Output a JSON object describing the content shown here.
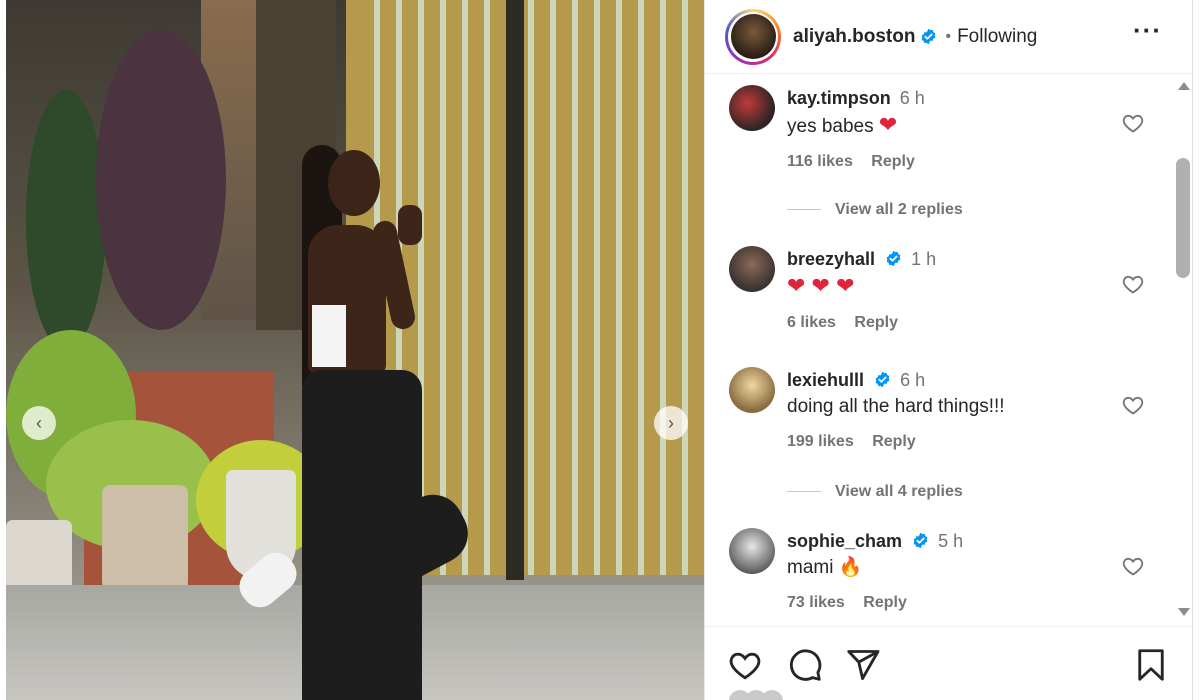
{
  "post": {
    "carousel_prev": "‹",
    "carousel_next": "›"
  },
  "header": {
    "username": "aliyah.boston",
    "separator": "•",
    "following_label": "Following",
    "more_label": "···"
  },
  "comments": [
    {
      "username": "kay.timpson",
      "time": "6 h",
      "text": "yes babes",
      "emoji": "❤",
      "likes": "116 likes",
      "reply": "Reply",
      "verified": false
    },
    {
      "username": "breezyhall",
      "time": "1 h",
      "text": "",
      "emoji": "❤ ❤ ❤",
      "likes": "6 likes",
      "reply": "Reply",
      "verified": true
    },
    {
      "username": "lexiehulll",
      "time": "6 h",
      "text": "doing all the hard things!!!",
      "emoji": "",
      "likes": "199 likes",
      "reply": "Reply",
      "verified": true
    },
    {
      "username": "sophie_cham",
      "time": "5 h",
      "text": "mami",
      "emoji": "🔥",
      "likes": "73 likes",
      "reply": "Reply",
      "verified": true
    }
  ],
  "view_replies": [
    {
      "label": "View all 2 replies"
    },
    {
      "label": "View all 4 replies"
    }
  ],
  "colors": {
    "verified_blue": "#0095f6",
    "heart_red": "#e0243b",
    "muted_text": "#737373"
  },
  "icons": {
    "like": "heart-icon",
    "comment": "comment-icon",
    "share": "paper-plane-icon",
    "save": "bookmark-icon",
    "more": "more-options-icon",
    "verified": "verified-badge-icon"
  }
}
